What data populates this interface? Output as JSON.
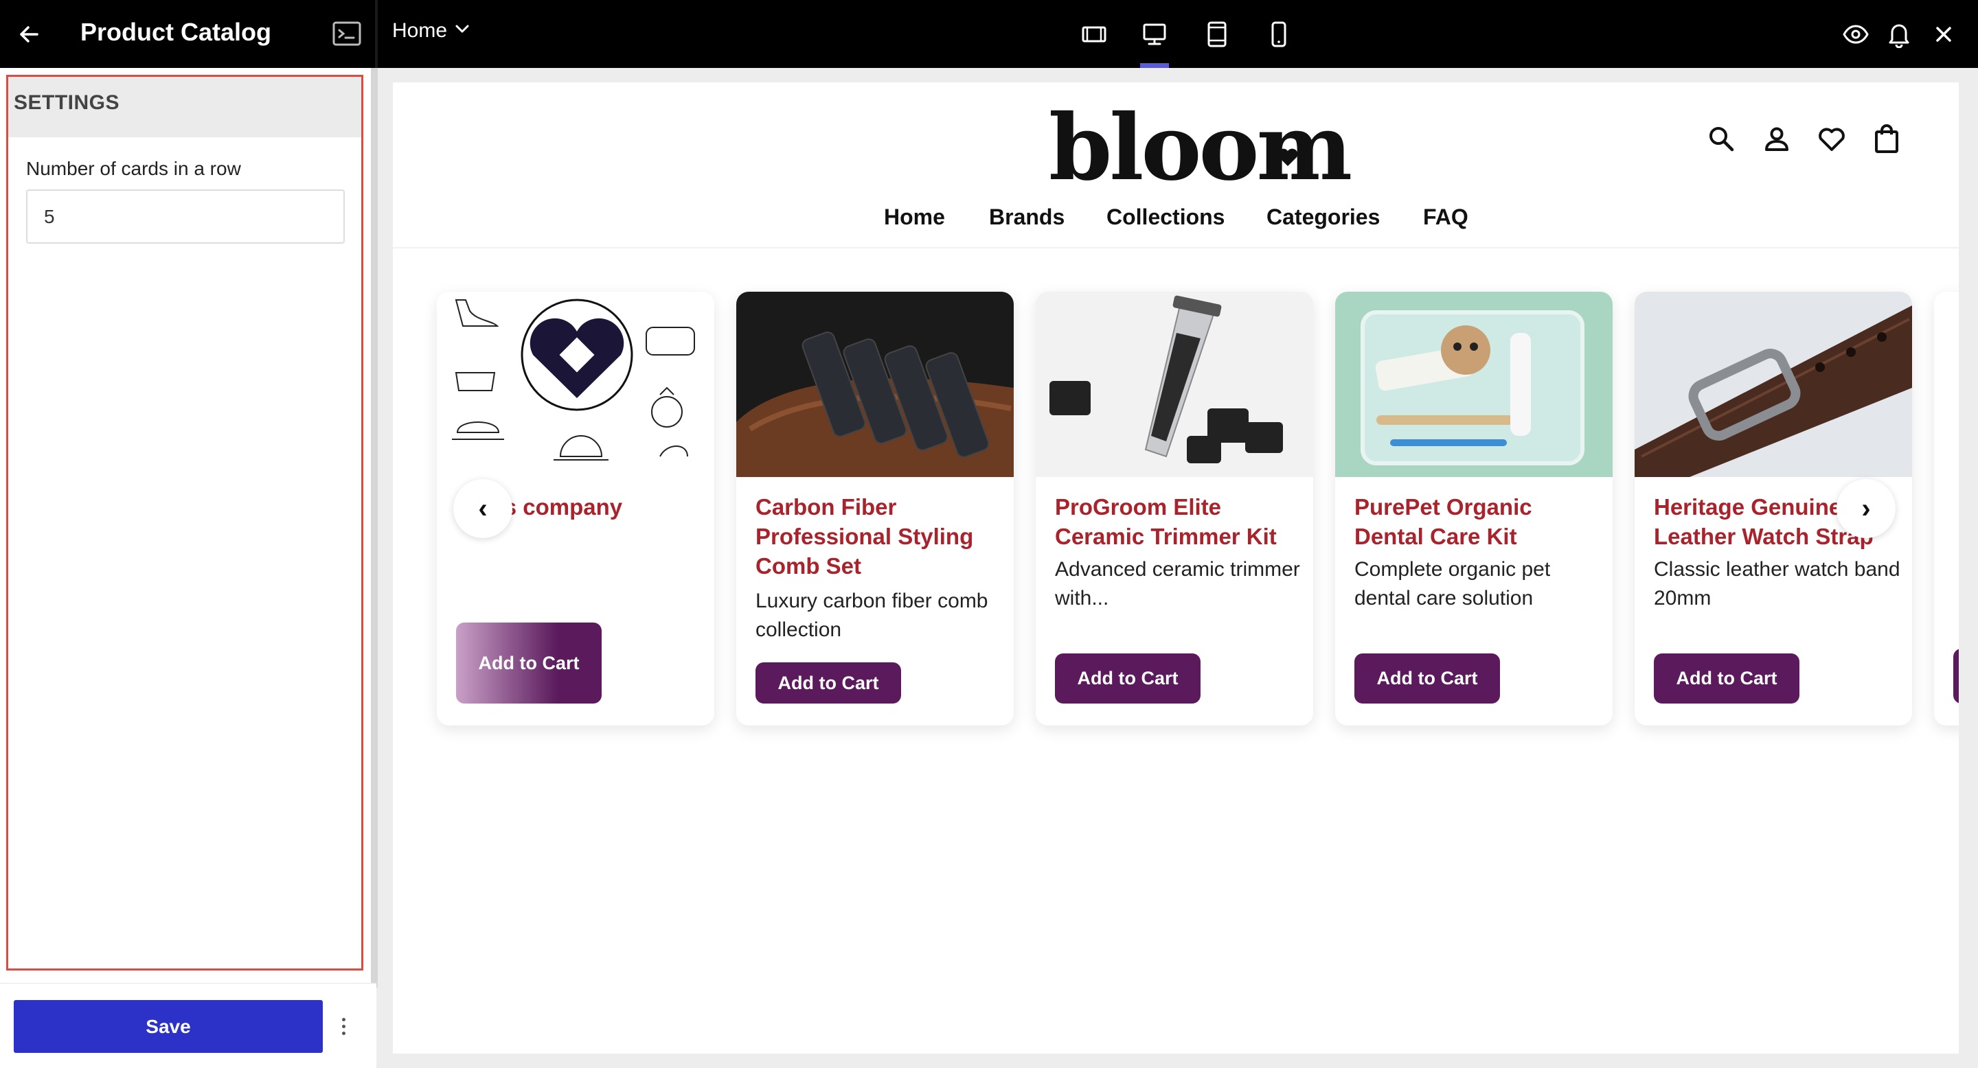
{
  "toolbar": {
    "title": "Product Catalog",
    "page_selector": "Home",
    "active_device": "desktop",
    "accent": "#5b5bd6"
  },
  "settings": {
    "title": "SETTINGS",
    "field_label": "Number of cards in a row",
    "cards_per_row": "5",
    "save_label": "Save",
    "outline_color": "#e04a3f",
    "save_color": "#2c32c8"
  },
  "store": {
    "logo": "bloom",
    "nav": [
      "Home",
      "Brands",
      "Collections",
      "Categories",
      "FAQ"
    ],
    "icons": [
      "search-icon",
      "account-icon",
      "wishlist-icon",
      "cart-icon"
    ],
    "title_color": "#a8232b",
    "button_color": "#5a1a5c",
    "prev_arrow": "‹",
    "next_arrow": "›"
  },
  "products": [
    {
      "title": "cross company",
      "description": "",
      "button": "Add to Cart"
    },
    {
      "title": "Carbon Fiber Professional Styling Comb Set",
      "description": "Luxury carbon fiber comb collection",
      "button": "Add to Cart"
    },
    {
      "title": "ProGroom Elite Ceramic Trimmer Kit",
      "description": "Advanced ceramic trimmer with...",
      "button": "Add to Cart"
    },
    {
      "title": "PurePet Organic Dental Care Kit",
      "description": "Complete organic pet dental care solution",
      "button": "Add to Cart"
    },
    {
      "title": "Heritage Genuine Leather Watch Strap",
      "description": "Classic leather watch band 20mm",
      "button": "Add to Cart"
    }
  ]
}
